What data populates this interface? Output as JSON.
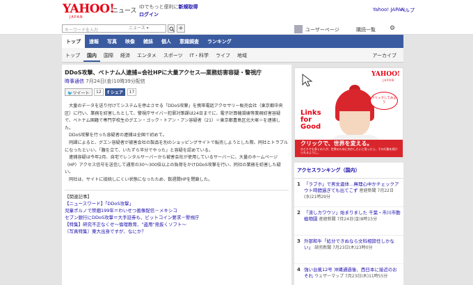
{
  "header": {
    "logo": "YAHOO!",
    "logo_sub": "JAPAN",
    "news_label": "ニュース",
    "id_promo_prefix": "IDでもっと便利に",
    "id_promo_link": "新規取得",
    "login": "ログイン",
    "top_link": "Yahoo! JAPAN",
    "help_link": "ヘルプ"
  },
  "search": {
    "placeholder": "キーワードを入力",
    "scope": "ニュース",
    "plus": "+"
  },
  "toolbar": {
    "user_page": "ユーザーページ",
    "subscribe": "購読一覧"
  },
  "nav_primary": [
    {
      "label": "トップ",
      "active": true
    },
    {
      "label": "速報",
      "active": false
    },
    {
      "label": "写真",
      "active": false
    },
    {
      "label": "映像",
      "active": false
    },
    {
      "label": "雑誌",
      "active": false
    },
    {
      "label": "個人",
      "active": false
    },
    {
      "label": "意識調査",
      "active": false
    },
    {
      "label": "ランキング",
      "active": false
    }
  ],
  "nav_secondary": [
    {
      "label": "トップ",
      "active": false
    },
    {
      "label": "国内",
      "active": true
    },
    {
      "label": "国際",
      "active": false
    },
    {
      "label": "経済",
      "active": false
    },
    {
      "label": "エンタメ",
      "active": false
    },
    {
      "label": "スポーツ",
      "active": false
    },
    {
      "label": "IT・科学",
      "active": false
    },
    {
      "label": "ライフ",
      "active": false
    },
    {
      "label": "地域",
      "active": false
    }
  ],
  "archive_label": "アーカイブ",
  "article": {
    "title": "DDoS攻撃、ベトナム人逮捕=会社HPに大量アクセス―業務妨害容疑・警視庁",
    "source": "時事通信",
    "datetime": "7月24日(金)10時39分配信",
    "tweet_label": "ツイート",
    "tweet_count": "12",
    "share_label": "シェア",
    "share_count": "17",
    "paragraphs": [
      "大量のデータを送り付けてシステムを停止させる「DDoS攻撃」を携帯電話アクセサリー販売会社（東京都中央区）に行い、業務を妨害したとして、警視庁サイバー犯罪対策課は24日までに、電子計算機損壊等業務妨害容疑で、ベトナム国籍で専門学校生のグエン・ゴック・トアン・アン容疑者（21）＝東京都豊島区北大塚＝を逮捕した。",
      "DDoS攻撃を行った容疑者の逮捕は全国で初めて。",
      "同課によると、グエン容疑者が被害会社の製品を別のショッピングサイトで転売しようとした際、同社とトラブルになったといい、「腹を立て、いたずら半分でやった」と容疑を認めている。",
      "逮捕容疑は今年2月、自宅でレンタルサーバーから被害会社が使用しているサーバーに、大量のホームページ（HP）アクセス信号を送信して通常の30～300倍以上の負荷をかけDDoS攻撃を行い、同社の業務を妨害した疑い。",
      "同社は、サイトに接続しにくい状態になったため、数週間HPを閉鎖した。"
    ]
  },
  "related": {
    "header": "【関連記事】",
    "links": [
      "【ニュースワード】「DDoS攻撃」",
      "児童ポルノで禁錮199年＝わいせつ画像配信－メキシコ",
      "セブン銀行にDDoS攻撃＝大手証券も、ビットコイン要求－警視庁",
      "【特集】研究不正なくせ～倫理教育、\"盗用\"見抜くソフト～",
      "〔写真特集〕東大出身ですが、なにか？"
    ]
  },
  "ad": {
    "brand": "YAHOO!",
    "brand_sub": "JAPAN",
    "bubble": "クリックしてみよう",
    "tagline": "Links for Good",
    "catch": "クリックで、世界を変える。",
    "small": "ひとりでも多くの人が、世界のために何かしたいと思ったら、その行動を続けられるように。"
  },
  "ranking": {
    "title": "アクセスランキング（国内）",
    "items": [
      {
        "num": "1",
        "text": "「ラブホ」で男女遺体…無理心中かチェックアウト時間過ぎても出てこず",
        "src": "産経新聞 7月22日(水)21時29分"
      },
      {
        "num": "2",
        "text": "「流しカワウソ」始まりました 千葉・市川市動植物園",
        "src": "産経新聞 7月24日(金)8時15分"
      },
      {
        "num": "3",
        "text": "外部和牛「処分できぬなら文科相辞任しかない」",
        "src": "読売新聞 7月23日(木)23時0分"
      },
      {
        "num": "4",
        "text": "強い台風12号 沖縄通過後、西日本に接近のおそれ",
        "src": "ウェザーマップ 7月23日(木)11時55分"
      }
    ]
  },
  "colors": {
    "nav_blue": "#3a5ba0",
    "brand_red": "#e60012",
    "link_blue": "#1a0dab"
  }
}
